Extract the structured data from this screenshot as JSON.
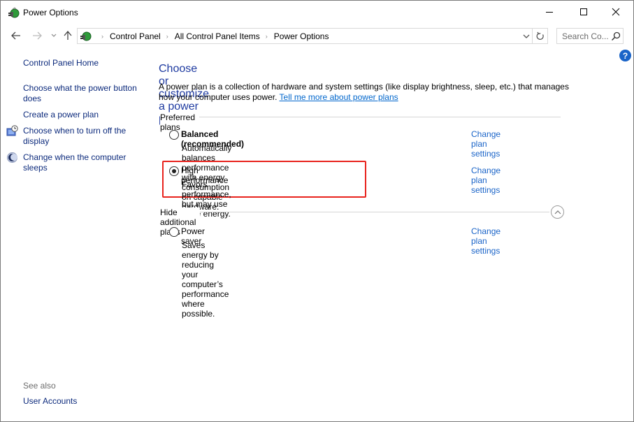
{
  "window": {
    "title": "Power Options",
    "controls": {
      "minimize": "minimize",
      "maximize": "maximize",
      "close": "close"
    }
  },
  "navigation": {
    "breadcrumbs": [
      "Control Panel",
      "All Control Panel Items",
      "Power Options"
    ],
    "search_placeholder": "Search Co..."
  },
  "sidebar": {
    "home": "Control Panel Home",
    "tasks": [
      {
        "label": "Choose what the power button does",
        "icon": null
      },
      {
        "label": "Create a power plan",
        "icon": null
      },
      {
        "label": "Choose when to turn off the display",
        "icon": "display-clock-icon"
      },
      {
        "label": "Change when the computer sleeps",
        "icon": "sleep-moon-icon"
      }
    ],
    "see_also_label": "See also",
    "see_also": [
      "User Accounts"
    ]
  },
  "main": {
    "heading": "Choose or customize a power plan",
    "description": "A power plan is a collection of hardware and system settings (like display brightness, sleep, etc.) that manages how your computer uses power.",
    "learn_more_link": "Tell me more about power plans",
    "preferred_group_label": "Preferred plans",
    "additional_group_label": "Hide additional plans",
    "change_link_label": "Change plan settings",
    "plans": [
      {
        "name": "Balanced (recommended)",
        "description": "Automatically balances performance with energy consumption on capable hardware.",
        "selected": false,
        "group": "preferred"
      },
      {
        "name": "High performance",
        "description": "Favors performance, but may use more energy.",
        "selected": true,
        "group": "preferred",
        "highlighted": true
      },
      {
        "name": "Power saver",
        "description": "Saves energy by reducing your computer’s performance where possible.",
        "selected": false,
        "group": "additional"
      }
    ]
  },
  "colors": {
    "heading": "#1e3aa0",
    "sidebar_link": "#0c2a7c",
    "link": "#1a64c8",
    "highlight_box": "#e8231d"
  }
}
